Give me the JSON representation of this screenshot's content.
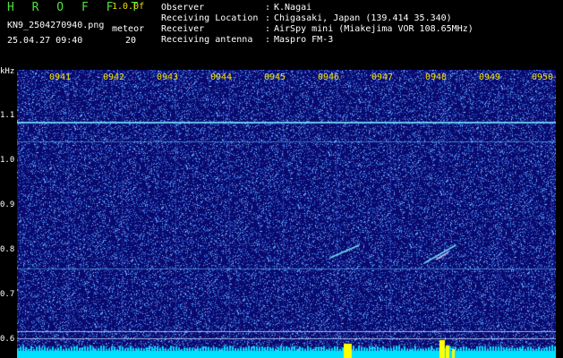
{
  "header": {
    "title": "H R O F F T",
    "version": "1.0.0f",
    "filename": "KN9_2504270940.png",
    "datetime": "25.04.27 09:40",
    "mode": "meteor",
    "mode_value": "20"
  },
  "info": [
    {
      "label": "Observer",
      "value": "K.Nagai"
    },
    {
      "label": "Receiving Location",
      "value": "Chigasaki, Japan (139.414 35.340)"
    },
    {
      "label": "Receiver",
      "value": "AirSpy mini (Miakejima VOR 108.65MHz)"
    },
    {
      "label": "Receiving antenna",
      "value": "Maspro FM-3"
    }
  ],
  "info_separator": ":",
  "spectrogram": {
    "y_unit": "kHz",
    "y_ticks": [
      "1.1",
      "1.0",
      "0.9",
      "0.8",
      "0.7",
      "0.6"
    ],
    "time_labels": [
      "0941",
      "0942",
      "0943",
      "0944",
      "0945",
      "0946",
      "0947",
      "0948",
      "0949",
      "0950"
    ],
    "colors": {
      "background": "#0a0a6e",
      "noise": "#4a8cff",
      "band": "#00e0ff",
      "bursts": "#ffff00"
    }
  }
}
